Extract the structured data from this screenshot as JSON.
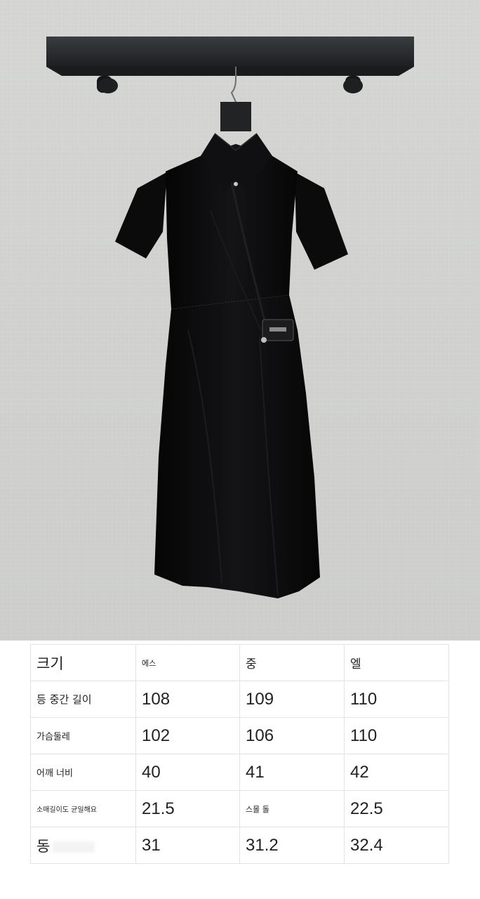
{
  "photo": {
    "subject": "black short-sleeve shirt dress on hanger",
    "label_text": "",
    "colors": {
      "wall": "#d2d3d1",
      "rail": "#2a2c2e",
      "dress": "#0c0c0d"
    }
  },
  "size_table": {
    "header": [
      "크기",
      "에스",
      "중",
      "엘"
    ],
    "rows": [
      {
        "label": "등 중간 길이",
        "values": [
          "108",
          "109",
          "110"
        ]
      },
      {
        "label": "가슴둘레",
        "values": [
          "102",
          "106",
          "110"
        ]
      },
      {
        "label": "어깨 너비",
        "values": [
          "40",
          "41",
          "42"
        ]
      },
      {
        "label": "소매길이도 균일해요",
        "values": [
          "21.5",
          "스몰 돌",
          "22.5"
        ]
      },
      {
        "label": "동",
        "values": [
          "31",
          "31.2",
          "32.4"
        ]
      }
    ]
  }
}
